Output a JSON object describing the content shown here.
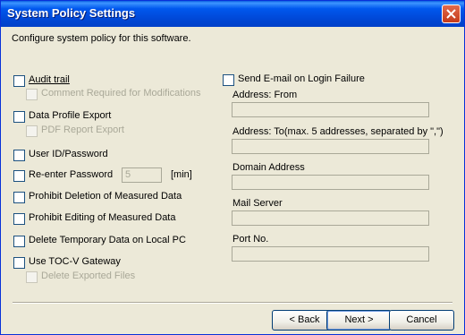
{
  "window": {
    "title": "System Policy Settings"
  },
  "description": "Configure system policy for this software.",
  "options": {
    "audit_trail": "Audit trail",
    "comment_required": "Comment Required for Modifications",
    "data_profile_export": "Data Profile Export",
    "pdf_report_export": "PDF Report Export",
    "user_id_password": "User ID/Password",
    "reenter_password": "Re-enter Password",
    "reenter_value": "5",
    "reenter_unit": "[min]",
    "prohibit_deletion": "Prohibit Deletion of Measured Data",
    "prohibit_editing": "Prohibit Editing of Measured Data",
    "delete_temp": "Delete Temporary Data on Local PC",
    "use_gateway": "Use TOC-V Gateway",
    "delete_exported": "Delete Exported Files"
  },
  "email": {
    "send_label": "Send E-mail on Login Failure",
    "address_from": "Address: From",
    "address_to": "Address: To(max. 5 addresses, separated by \",\")",
    "domain_address": "Domain Address",
    "mail_server": "Mail Server",
    "port_no": "Port No."
  },
  "buttons": {
    "back": "< Back",
    "next": "Next >",
    "cancel": "Cancel"
  }
}
